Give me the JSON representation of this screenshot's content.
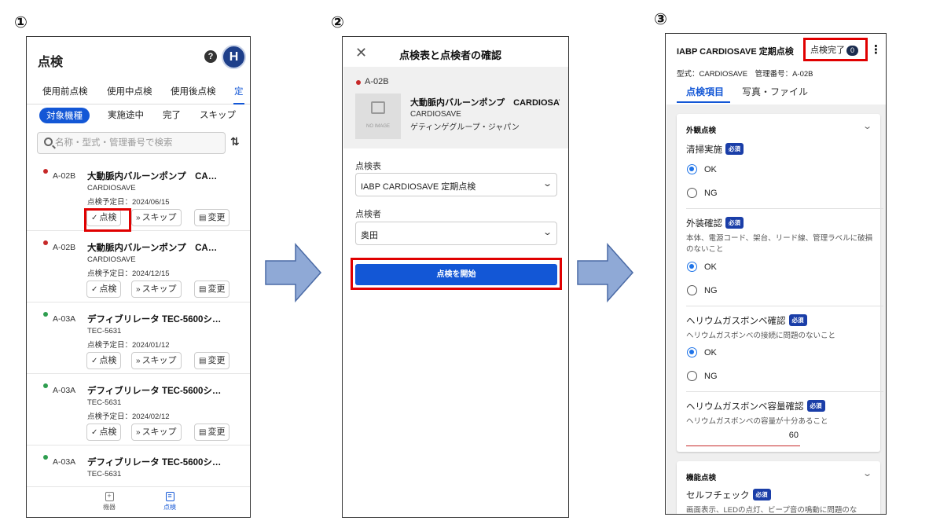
{
  "steps": [
    "①",
    "②",
    "③"
  ],
  "screen1": {
    "title": "点検",
    "help_icon": "?",
    "avatar": "H",
    "tabs": [
      {
        "label": "使用前点検"
      },
      {
        "label": "使用中点検"
      },
      {
        "label": "使用後点検"
      },
      {
        "label": "定"
      }
    ],
    "chips": [
      {
        "label": "対象機種"
      },
      {
        "label": "実施途中"
      },
      {
        "label": "完了"
      },
      {
        "label": "スキップ"
      }
    ],
    "search": {
      "placeholder": "名称・型式・管理番号で検索"
    },
    "sort_icon": "⇅",
    "items": [
      {
        "code": "A-02B",
        "name": "大動脈内バルーンポンプ　CA…",
        "model": "CARDIOSAVE",
        "date": "点検予定日：2024/06/15",
        "status_color": "#c62828"
      },
      {
        "code": "A-02B",
        "name": "大動脈内バルーンポンプ　CA…",
        "model": "CARDIOSAVE",
        "date": "点検予定日：2024/12/15",
        "status_color": "#c62828"
      },
      {
        "code": "A-03A",
        "name": "デフィブリレータ TEC-5600シ…",
        "model": "TEC-5631",
        "date": "点検予定日：2024/01/12",
        "status_color": "#2e9e4f"
      },
      {
        "code": "A-03A",
        "name": "デフィブリレータ TEC-5600シ…",
        "model": "TEC-5631",
        "date": "点検予定日：2024/02/12",
        "status_color": "#2e9e4f"
      },
      {
        "code": "A-03A",
        "name": "デフィブリレータ TEC-5600シ…",
        "model": "TEC-5631",
        "date": "",
        "status_color": "#2e9e4f"
      }
    ],
    "buttons": {
      "inspect": "点検",
      "skip": "スキップ",
      "change": "変更"
    },
    "bottom_nav": [
      {
        "label": "機器",
        "icon": "plus-square-icon"
      },
      {
        "label": "点検",
        "icon": "clipboard-icon"
      }
    ]
  },
  "screen2": {
    "title": "点検表と点検者の確認",
    "device": {
      "code": "A-02B",
      "no_image": "NO IMAGE",
      "name": "大動脈内バルーンポンプ　CARDIOSAVE",
      "model": "CARDIOSAVE",
      "maker": "ゲティンゲグループ・ジャパン"
    },
    "checklist_label": "点検表",
    "checklist_value": "IABP CARDIOSAVE 定期点検",
    "inspector_label": "点検者",
    "inspector_value": "奥田",
    "start_button": "点検を開始"
  },
  "screen3": {
    "title": "IABP CARDIOSAVE 定期点検",
    "complete_label": "点検完了",
    "complete_count": "0",
    "meta": "型式：CARDIOSAVE　管理番号：A-02B",
    "tabs": [
      {
        "label": "点検項目"
      },
      {
        "label": "写真・ファイル"
      }
    ],
    "required_badge": "必須",
    "section1": {
      "title": "外観点検",
      "questions": [
        {
          "label": "清掃実施",
          "desc": ""
        },
        {
          "label": "外装確認",
          "desc": "本体、電源コード、架台、リード線、管理ラベルに破損のないこと"
        },
        {
          "label": "ヘリウムガスボンベ確認",
          "desc": "ヘリウムガスボンベの接続に問題のないこと"
        },
        {
          "label": "ヘリウムガスボンベ容量確認",
          "desc": "ヘリウムガスボンベの容量が十分あること",
          "value": "60"
        }
      ],
      "ok": "OK",
      "ng": "NG"
    },
    "section2": {
      "title": "機能点検",
      "questions": [
        {
          "label": "セルフチェック",
          "desc": "画面表示、LEDの点灯、ビープ音の鳴動に問題のな"
        }
      ]
    }
  }
}
